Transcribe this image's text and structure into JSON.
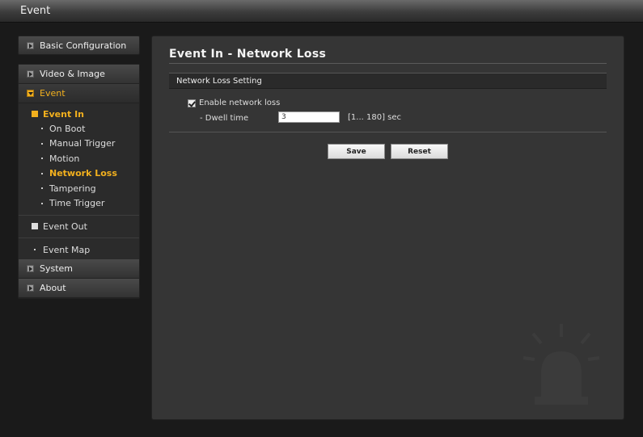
{
  "window": {
    "title": "Event"
  },
  "sidebar": {
    "basic_configuration": "Basic Configuration",
    "video_image": "Video & Image",
    "event": "Event",
    "event_in": "Event In",
    "event_in_items": [
      "On Boot",
      "Manual Trigger",
      "Motion",
      "Network Loss",
      "Tampering",
      "Time Trigger"
    ],
    "event_out": "Event Out",
    "event_map": "Event Map",
    "system": "System",
    "about": "About"
  },
  "main": {
    "title": "Event In - Network Loss",
    "section_title": "Network Loss Setting",
    "enable_label": "Enable network loss",
    "enable_checked": true,
    "dwell_label": "- Dwell time",
    "dwell_value": "3",
    "dwell_range": "[1... 180] sec",
    "save_label": "Save",
    "reset_label": "Reset"
  },
  "colors": {
    "accent": "#f2b01e",
    "background": "#1a1a1a",
    "panel": "#353535"
  }
}
